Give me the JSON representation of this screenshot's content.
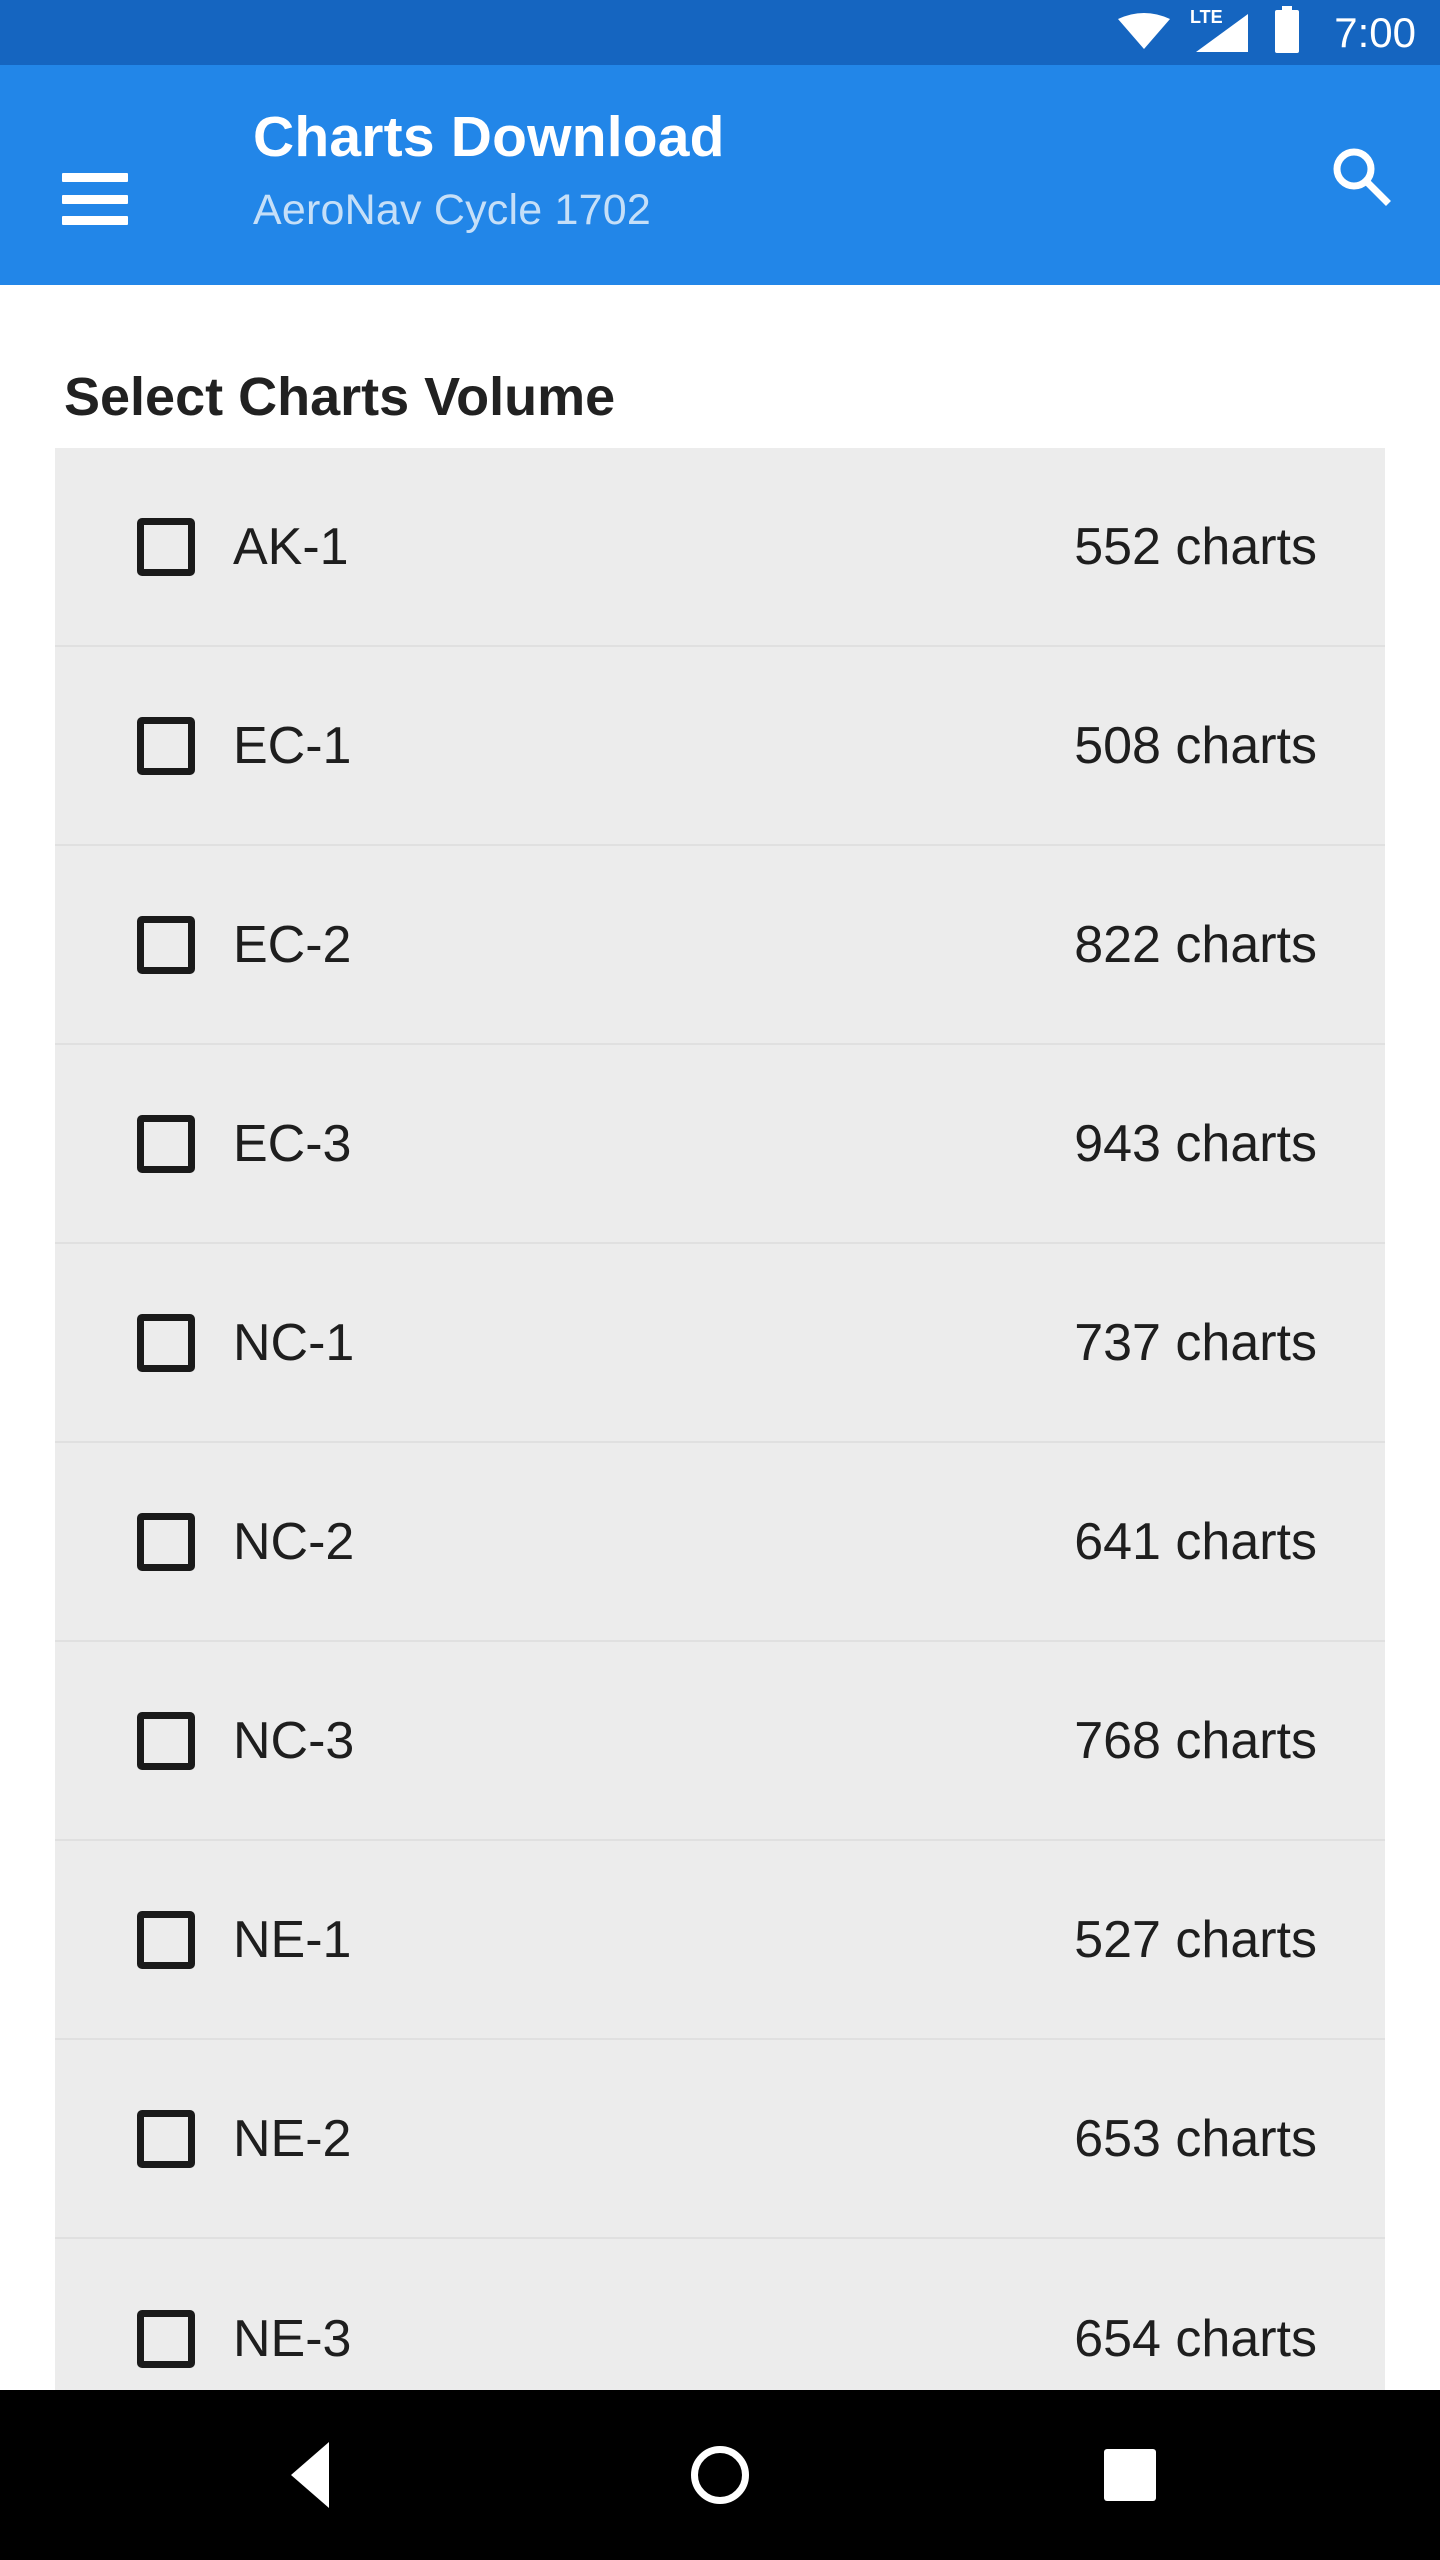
{
  "theme": {
    "status_bar_color": "#1565C0",
    "app_bar_color": "#2286E8",
    "row_bg": "#ECECEC",
    "page_bg": "#FFFFFF",
    "nav_bar_color": "#000000",
    "subtitle_color": "#C5DFF8"
  },
  "status_bar": {
    "time": "7:00",
    "network_label": "LTE",
    "icons": [
      "wifi-icon",
      "cellular-signal-icon",
      "battery-icon"
    ]
  },
  "app_bar": {
    "menu_icon": "hamburger-menu-icon",
    "title": "Charts Download",
    "subtitle": "AeroNav Cycle 1702",
    "search_icon": "search-icon"
  },
  "main": {
    "section_title": "Select Charts Volume",
    "count_suffix": "charts",
    "rows": [
      {
        "label": "AK-1",
        "count": "552 charts",
        "checked": false
      },
      {
        "label": "EC-1",
        "count": "508 charts",
        "checked": false
      },
      {
        "label": "EC-2",
        "count": "822 charts",
        "checked": false
      },
      {
        "label": "EC-3",
        "count": "943 charts",
        "checked": false
      },
      {
        "label": "NC-1",
        "count": "737 charts",
        "checked": false
      },
      {
        "label": "NC-2",
        "count": "641 charts",
        "checked": false
      },
      {
        "label": "NC-3",
        "count": "768 charts",
        "checked": false
      },
      {
        "label": "NE-1",
        "count": "527 charts",
        "checked": false
      },
      {
        "label": "NE-2",
        "count": "653 charts",
        "checked": false
      },
      {
        "label": "NE-3",
        "count": "654 charts",
        "checked": false
      }
    ]
  },
  "nav_bar": {
    "back_icon": "back-triangle-icon",
    "home_icon": "home-circle-icon",
    "recents_icon": "recents-square-icon"
  }
}
